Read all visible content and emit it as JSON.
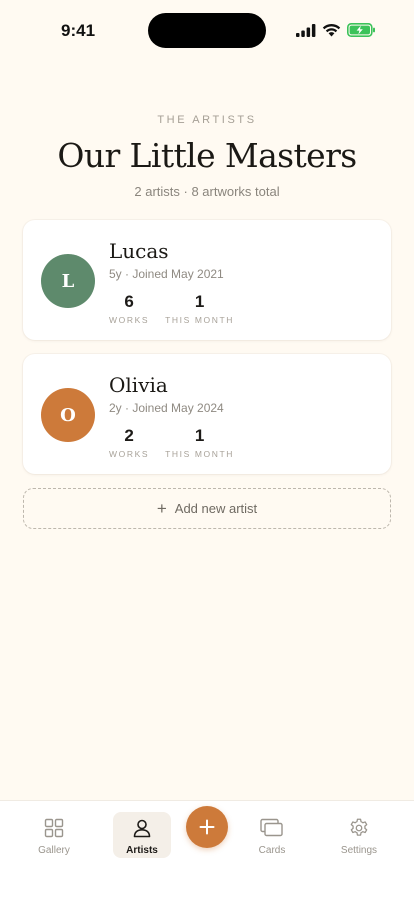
{
  "status_bar": {
    "time": "9:41"
  },
  "header": {
    "eyebrow": "THE ARTISTS",
    "title": "Our Little Masters",
    "subtitle": "2 artists · 8 artworks total"
  },
  "artists": [
    {
      "initial": "L",
      "name": "Lucas",
      "meta": "5y · Joined May 2021",
      "avatar_color": "#5e8a6c",
      "works": "6",
      "this_month": "1"
    },
    {
      "initial": "O",
      "name": "Olivia",
      "meta": "2y · Joined May 2024",
      "avatar_color": "#cd7a3a",
      "works": "2",
      "this_month": "1"
    }
  ],
  "stat_labels": {
    "works": "WORKS",
    "this_month": "THIS MONTH"
  },
  "add_artist": {
    "plus": "+",
    "label": "Add new artist"
  },
  "tab_bar": {
    "tabs": [
      {
        "label": "Gallery",
        "icon": "grid-icon",
        "active": false
      },
      {
        "label": "Artists",
        "icon": "person-icon",
        "active": true
      },
      {
        "label": "Cards",
        "icon": "cards-icon",
        "active": false
      },
      {
        "label": "Settings",
        "icon": "gear-icon",
        "active": false
      }
    ],
    "fab_icon": "plus-icon"
  },
  "colors": {
    "background": "#fffaf2",
    "accent": "#cd7a3a",
    "green": "#5e8a6c"
  }
}
